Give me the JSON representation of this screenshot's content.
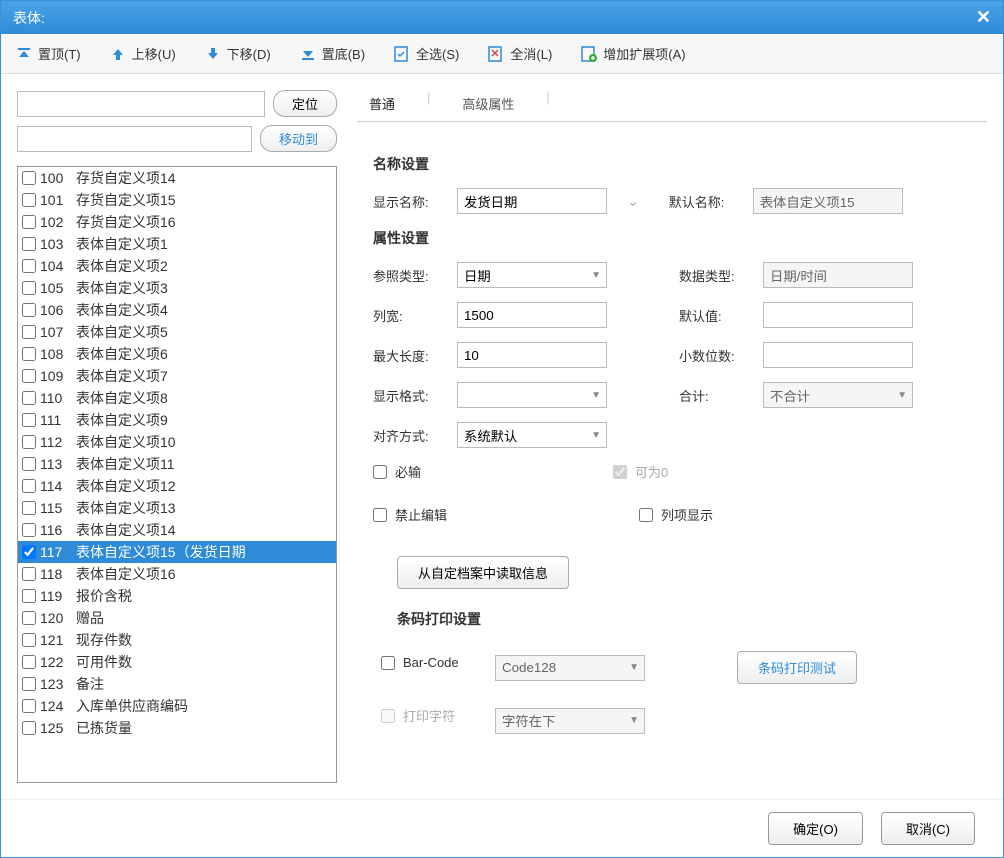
{
  "title": "表体:",
  "toolbar": {
    "top": "置顶(T)",
    "up": "上移(U)",
    "down": "下移(D)",
    "bottom": "置底(B)",
    "selectAll": "全选(S)",
    "deselectAll": "全消(L)",
    "addExt": "增加扩展项(A)"
  },
  "left": {
    "locate": "定位",
    "moveTo": "移动到",
    "items": [
      {
        "num": "100",
        "label": "存货自定义项14",
        "checked": false,
        "selected": false
      },
      {
        "num": "101",
        "label": "存货自定义项15",
        "checked": false,
        "selected": false
      },
      {
        "num": "102",
        "label": "存货自定义项16",
        "checked": false,
        "selected": false
      },
      {
        "num": "103",
        "label": "表体自定义项1",
        "checked": false,
        "selected": false
      },
      {
        "num": "104",
        "label": "表体自定义项2",
        "checked": false,
        "selected": false
      },
      {
        "num": "105",
        "label": "表体自定义项3",
        "checked": false,
        "selected": false
      },
      {
        "num": "106",
        "label": "表体自定义项4",
        "checked": false,
        "selected": false
      },
      {
        "num": "107",
        "label": "表体自定义项5",
        "checked": false,
        "selected": false
      },
      {
        "num": "108",
        "label": "表体自定义项6",
        "checked": false,
        "selected": false
      },
      {
        "num": "109",
        "label": "表体自定义项7",
        "checked": false,
        "selected": false
      },
      {
        "num": "110",
        "label": "表体自定义项8",
        "checked": false,
        "selected": false
      },
      {
        "num": "111",
        "label": "表体自定义项9",
        "checked": false,
        "selected": false
      },
      {
        "num": "112",
        "label": "表体自定义项10",
        "checked": false,
        "selected": false
      },
      {
        "num": "113",
        "label": "表体自定义项11",
        "checked": false,
        "selected": false
      },
      {
        "num": "114",
        "label": "表体自定义项12",
        "checked": false,
        "selected": false
      },
      {
        "num": "115",
        "label": "表体自定义项13",
        "checked": false,
        "selected": false
      },
      {
        "num": "116",
        "label": "表体自定义项14",
        "checked": false,
        "selected": false
      },
      {
        "num": "117",
        "label": "表体自定义项15（发货日期",
        "checked": true,
        "selected": true
      },
      {
        "num": "118",
        "label": "表体自定义项16",
        "checked": false,
        "selected": false
      },
      {
        "num": "119",
        "label": "报价含税",
        "checked": false,
        "selected": false
      },
      {
        "num": "120",
        "label": "赠品",
        "checked": false,
        "selected": false
      },
      {
        "num": "121",
        "label": "现存件数",
        "checked": false,
        "selected": false
      },
      {
        "num": "122",
        "label": "可用件数",
        "checked": false,
        "selected": false
      },
      {
        "num": "123",
        "label": "备注",
        "checked": false,
        "selected": false
      },
      {
        "num": "124",
        "label": "入库单供应商编码",
        "checked": false,
        "selected": false
      },
      {
        "num": "125",
        "label": "已拣货量",
        "checked": false,
        "selected": false
      }
    ]
  },
  "tabs": {
    "normal": "普通",
    "advanced": "高级属性"
  },
  "section": {
    "name": "名称设置",
    "attr": "属性设置",
    "barcode": "条码打印设置"
  },
  "labels": {
    "displayName": "显示名称:",
    "defaultName": "默认名称:",
    "refType": "参照类型:",
    "dataType": "数据类型:",
    "colWidth": "列宽:",
    "defaultVal": "默认值:",
    "maxLen": "最大长度:",
    "decimals": "小数位数:",
    "dispFmt": "显示格式:",
    "total": "合计:",
    "align": "对齐方式:",
    "required": "必输",
    "allowZero": "可为0",
    "noEdit": "禁止编辑",
    "colShow": "列项显示",
    "barCode": "Bar-Code",
    "printChar": "打印字符"
  },
  "values": {
    "displayName": "发货日期",
    "defaultName": "表体自定义项15",
    "refType": "日期",
    "dataType": "日期/时间",
    "colWidth": "1500",
    "defaultVal": "",
    "maxLen": "10",
    "decimals": "",
    "dispFmt": "",
    "total": "不合计",
    "align": "系统默认",
    "barCodeType": "Code128",
    "printCharPos": "字符在下"
  },
  "buttons": {
    "readFromArchive": "从自定档案中读取信息",
    "barcodeTest": "条码打印测试",
    "ok": "确定(O)",
    "cancel": "取消(C)"
  }
}
